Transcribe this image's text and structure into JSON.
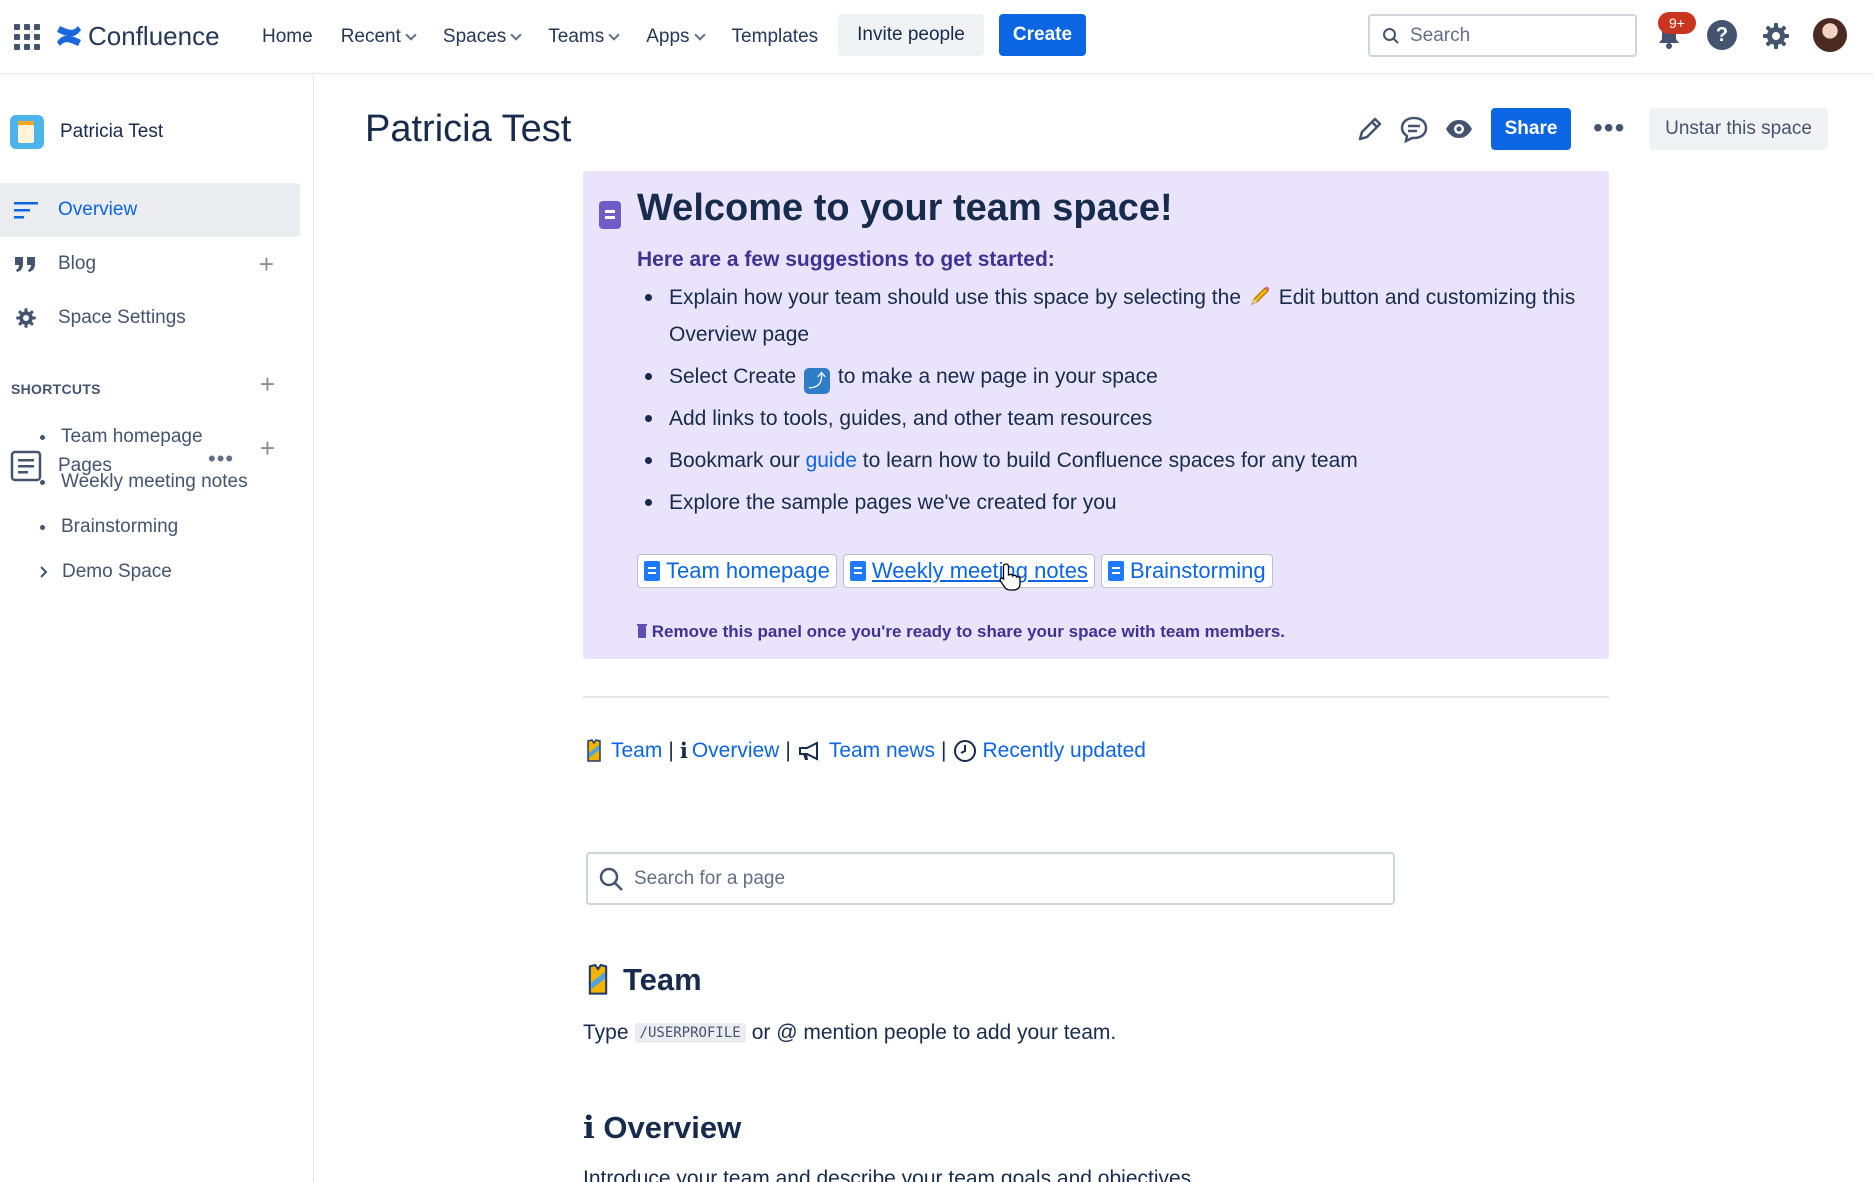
{
  "topbar": {
    "app_name": "Confluence",
    "nav": [
      {
        "label": "Home",
        "dropdown": false
      },
      {
        "label": "Recent",
        "dropdown": true
      },
      {
        "label": "Spaces",
        "dropdown": true
      },
      {
        "label": "Teams",
        "dropdown": true
      },
      {
        "label": "Apps",
        "dropdown": true
      },
      {
        "label": "Templates",
        "dropdown": false
      }
    ],
    "invite_label": "Invite people",
    "create_label": "Create",
    "search_placeholder": "Search",
    "notification_badge": "9+",
    "help_glyph": "?"
  },
  "sidebar": {
    "space_name": "Patricia Test",
    "items": [
      {
        "label": "Overview",
        "icon": "overview-lines-icon"
      },
      {
        "label": "Blog",
        "icon": "quote-icon"
      },
      {
        "label": "Space Settings",
        "icon": "gear-icon"
      }
    ],
    "shortcuts_label": "SHORTCUTS",
    "pages_label": "Pages",
    "pages": [
      {
        "label": "Team homepage"
      },
      {
        "label": "Weekly meeting notes"
      },
      {
        "label": "Brainstorming"
      },
      {
        "label": "Demo Space"
      }
    ]
  },
  "main": {
    "title": "Patricia Test",
    "share_label": "Share",
    "unstar_label": "Unstar this space",
    "panel": {
      "title": "Welcome to your team space!",
      "subtitle": "Here are a few suggestions to get started:",
      "bullets": {
        "b1_pre": "Explain how your team should use this space by selecting the",
        "b1_post": "Edit button and customizing this Overview page",
        "b2_pre": "Select Create",
        "b2_post": "to make a new page in your space",
        "b3": "Add links to tools, guides, and other team resources",
        "b4_pre": "Bookmark our",
        "b4_link": "guide",
        "b4_post": "to learn how to build Confluence spaces for any team",
        "b5": "Explore the sample pages we've created for you"
      },
      "chips": [
        "Team homepage",
        "Weekly meeting notes",
        "Brainstorming"
      ],
      "note": "Remove this panel once you're ready to share your space with team members."
    },
    "quicklinks": {
      "team": "Team",
      "overview": "Overview",
      "news": "Team news",
      "recent": "Recently updated",
      "sep": "|"
    },
    "page_search_placeholder": "Search for a page",
    "team_section": {
      "heading": "Team",
      "text_pre": "Type",
      "code": "/USERPROFILE",
      "text_post": "or @ mention people to add your team."
    },
    "overview_section": {
      "heading": "ℹ Overview",
      "text": "Introduce your team and describe your team goals and objectives."
    }
  },
  "colors": {
    "brand_blue": "#0c66e4",
    "panel_bg": "#e9e3fb",
    "panel_accent": "#403294",
    "badge_red": "#ca3521"
  }
}
